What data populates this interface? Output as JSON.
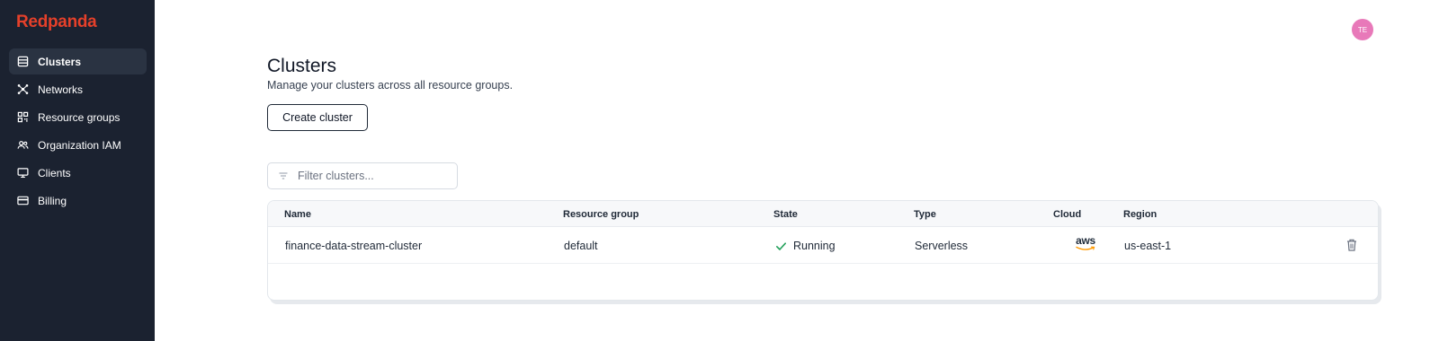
{
  "app": {
    "logo": "Redpanda"
  },
  "sidebar": {
    "items": [
      {
        "label": "Clusters",
        "icon": "clusters-icon",
        "active": true
      },
      {
        "label": "Networks",
        "icon": "network-icon",
        "active": false
      },
      {
        "label": "Resource groups",
        "icon": "resource-groups-icon",
        "active": false
      },
      {
        "label": "Organization IAM",
        "icon": "users-icon",
        "active": false
      },
      {
        "label": "Clients",
        "icon": "monitor-icon",
        "active": false
      },
      {
        "label": "Billing",
        "icon": "credit-card-icon",
        "active": false
      }
    ]
  },
  "user": {
    "initials": "TE",
    "avatar_color": "#e879b9"
  },
  "main": {
    "title": "Clusters",
    "subtitle": "Manage your clusters across all resource groups.",
    "create_button": "Create cluster",
    "filter": {
      "placeholder": "Filter clusters...",
      "value": ""
    },
    "table": {
      "columns": [
        "Name",
        "Resource group",
        "State",
        "Type",
        "Cloud",
        "Region"
      ],
      "rows": [
        {
          "name": "finance-data-stream-cluster",
          "resource_group": "default",
          "state": "Running",
          "type": "Serverless",
          "cloud": "aws",
          "region": "us-east-1"
        }
      ]
    }
  },
  "colors": {
    "brand": "#e5402a",
    "sidebar_bg": "#1b2230",
    "sidebar_active": "#2a3342",
    "status_running": "#22a05a",
    "aws_smile": "#ff9900"
  }
}
